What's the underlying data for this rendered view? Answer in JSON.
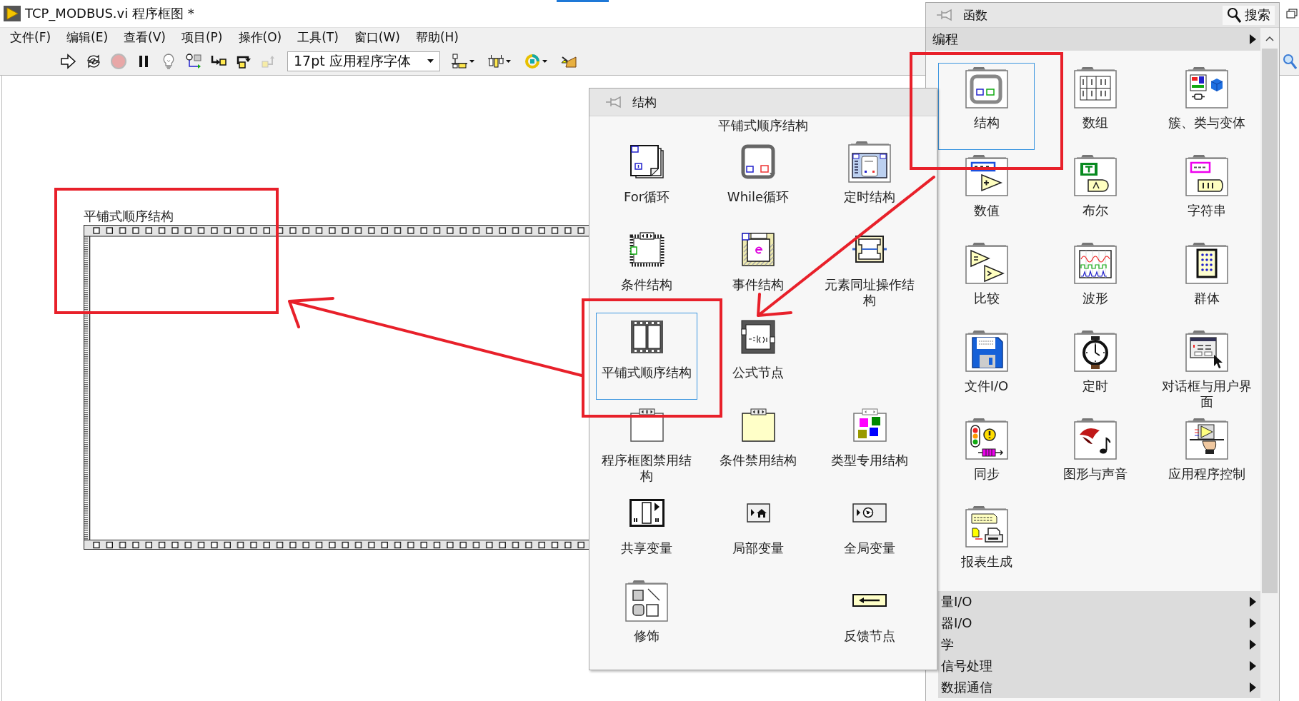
{
  "window": {
    "title": "TCP_MODBUS.vi 程序框图 *"
  },
  "menu": [
    "文件(F)",
    "编辑(E)",
    "查看(V)",
    "项目(P)",
    "操作(O)",
    "工具(T)",
    "窗口(W)",
    "帮助(H)"
  ],
  "toolbar": {
    "buttons": [
      {
        "kind": "run",
        "disabled": false
      },
      {
        "kind": "repeat",
        "disabled": false
      },
      {
        "kind": "abort",
        "disabled": true
      },
      {
        "kind": "pause",
        "disabled": false
      },
      {
        "kind": "highlight",
        "disabled": false
      },
      {
        "kind": "retain",
        "disabled": false
      },
      {
        "kind": "stepinto",
        "disabled": false
      },
      {
        "kind": "stepover",
        "disabled": false
      },
      {
        "kind": "stepout",
        "disabled": true
      }
    ],
    "font": {
      "value": "17pt 应用程序字体"
    },
    "tools": [
      {
        "kind": "align"
      },
      {
        "kind": "distribute"
      },
      {
        "kind": "reorder"
      },
      {
        "kind": "cleanup"
      }
    ]
  },
  "diagram": {
    "structure": {
      "label": "平铺式顺序结构"
    }
  },
  "structures_palette": {
    "title": "结构",
    "hover_label": "平铺式顺序结构",
    "rows": [
      {
        "col_1": {
          "kind": "for",
          "label": "For循环",
          "selected": false
        },
        "col_2": {
          "kind": "while",
          "label": "While循环",
          "selected": false
        },
        "col_3": {
          "kind": "timed",
          "label": "定时结构",
          "selected": false
        }
      },
      {
        "col_1": {
          "kind": "case",
          "label": "条件结构",
          "selected": false
        },
        "col_2": {
          "kind": "event",
          "label": "事件结构",
          "selected": false
        },
        "col_3": {
          "kind": "inplace",
          "label": "元素同址操作结构",
          "selected": false
        }
      },
      {
        "col_1": {
          "kind": "flat",
          "label": "平铺式顺序结构",
          "selected": true
        },
        "col_2": {
          "kind": "formula",
          "label": "公式节点",
          "selected": false
        }
      },
      {
        "col_1": {
          "kind": "diagramdisable",
          "label": "程序框图禁用结构",
          "selected": false
        },
        "col_2": {
          "kind": "conddisable",
          "label": "条件禁用结构",
          "selected": false
        },
        "col_3": {
          "kind": "typespecial",
          "label": "类型专用结构",
          "selected": false
        }
      },
      {
        "col_1": {
          "kind": "shared",
          "label": "共享变量",
          "selected": false
        },
        "col_2": {
          "kind": "local",
          "label": "局部变量",
          "selected": false
        },
        "col_3": {
          "kind": "global",
          "label": "全局变量",
          "selected": false
        }
      },
      {
        "col_1": {
          "kind": "decoration",
          "label": "修饰",
          "selected": false
        },
        "col_3": {
          "kind": "feedback",
          "label": "反馈节点",
          "selected": false
        }
      }
    ]
  },
  "functions_palette": {
    "title": "函数",
    "search": "搜索",
    "category": "编程",
    "items": [
      {
        "kind": "structures",
        "label": "结构",
        "selected": true
      },
      {
        "kind": "array",
        "label": "数组",
        "selected": false
      },
      {
        "kind": "cluster",
        "label": "簇、类与变体",
        "selected": false
      },
      {
        "kind": "numeric",
        "label": "数值",
        "selected": false
      },
      {
        "kind": "boolean",
        "label": "布尔",
        "selected": false
      },
      {
        "kind": "string",
        "label": "字符串",
        "selected": false
      },
      {
        "kind": "comparison",
        "label": "比较",
        "selected": false
      },
      {
        "kind": "waveform",
        "label": "波形",
        "selected": false
      },
      {
        "kind": "collection",
        "label": "群体",
        "selected": false
      },
      {
        "kind": "fileio",
        "label": "文件I/O",
        "selected": false
      },
      {
        "kind": "timing",
        "label": "定时",
        "selected": false
      },
      {
        "kind": "dialog",
        "label": "对话框与用户界面",
        "selected": false
      },
      {
        "kind": "sync",
        "label": "同步",
        "selected": false
      },
      {
        "kind": "graphics",
        "label": "图形与声音",
        "selected": false
      },
      {
        "kind": "appcontrol",
        "label": "应用程序控制",
        "selected": false
      },
      {
        "kind": "report",
        "label": "报表生成",
        "selected": false
      }
    ],
    "subcategories": [
      "量I/O",
      "器I/O",
      "学",
      "信号处理",
      "数据通信"
    ]
  }
}
